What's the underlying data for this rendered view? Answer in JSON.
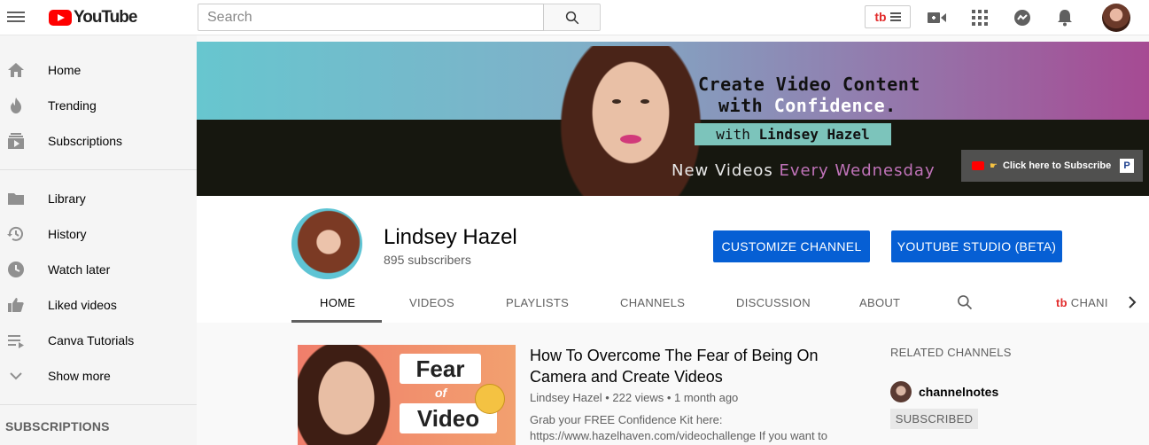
{
  "header": {
    "logo_text": "YouTube",
    "search_placeholder": "Search",
    "extension_label": "tb"
  },
  "sidebar": {
    "items": [
      {
        "label": "Home",
        "icon": "home-icon"
      },
      {
        "label": "Trending",
        "icon": "flame-icon"
      },
      {
        "label": "Subscriptions",
        "icon": "subscriptions-icon"
      },
      {
        "label": "Library",
        "icon": "folder-icon"
      },
      {
        "label": "History",
        "icon": "history-icon"
      },
      {
        "label": "Watch later",
        "icon": "clock-icon"
      },
      {
        "label": "Liked videos",
        "icon": "thumbs-up-icon"
      },
      {
        "label": "Canva Tutorials",
        "icon": "playlist-icon"
      },
      {
        "label": "Show more",
        "icon": "chevron-down-icon"
      }
    ],
    "subscriptions_heading": "SUBSCRIPTIONS"
  },
  "banner": {
    "line1": "Create Video Content",
    "line2_prefix": "with ",
    "line2_highlight": "Confidence",
    "line2_suffix": ".",
    "line3_prefix": "with ",
    "line3_name": "Lindsey Hazel",
    "line4_prefix": "New Videos ",
    "line4_highlight": "Every Wednesday",
    "subscribe_overlay": "Click here to Subscribe",
    "paypal_label": "P"
  },
  "channel": {
    "name": "Lindsey Hazel",
    "subscribers": "895 subscribers",
    "customize_button": "CUSTOMIZE CHANNEL",
    "studio_button": "YOUTUBE STUDIO (BETA)",
    "tabs": [
      "HOME",
      "VIDEOS",
      "PLAYLISTS",
      "CHANNELS",
      "DISCUSSION",
      "ABOUT"
    ],
    "extra_tab": "CHANI",
    "extra_tab_prefix": "tb",
    "active_tab": "HOME"
  },
  "featured_video": {
    "thumbnail": {
      "word1": "Fear",
      "word2": "of",
      "word3": "Video"
    },
    "title": "How To Overcome The Fear of Being On Camera and Create Videos",
    "meta": "Lindsey Hazel • 222 views • 1 month ago",
    "description": "Grab your FREE Confidence Kit here: https://www.hazelhaven.com/videochallenge If you want to"
  },
  "related_channels": {
    "heading": "RELATED CHANNELS",
    "items": [
      {
        "name": "channelnotes",
        "button": "SUBSCRIBED"
      }
    ]
  },
  "colors": {
    "accent_blue": "#065fd4",
    "youtube_red": "#ff0000",
    "banner_teal": "#67c6cf",
    "banner_magenta": "#a64a93"
  }
}
